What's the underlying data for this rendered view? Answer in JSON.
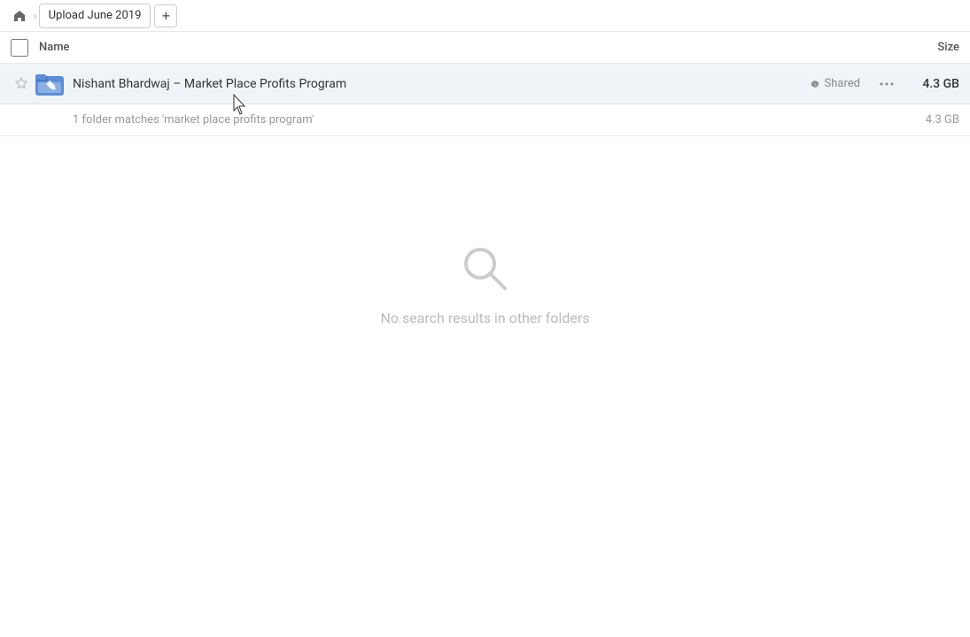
{
  "topbar": {
    "home_label": "Home",
    "breadcrumb_tab": "Upload June 2019",
    "add_tab_label": "+"
  },
  "table": {
    "header_name": "Name",
    "header_size": "Size"
  },
  "file_row": {
    "name": "Nishant Bhardwaj – Market Place Profits Program",
    "shared_label": "Shared",
    "size": "4.3 GB"
  },
  "match_row": {
    "text": "1 folder matches 'market place profits program'",
    "size": "4.3 GB"
  },
  "empty_state": {
    "message": "No search results in other folders"
  },
  "icons": {
    "home": "⌂",
    "star": "☆",
    "link": "🔗",
    "more": "•••",
    "search": "search-icon"
  }
}
